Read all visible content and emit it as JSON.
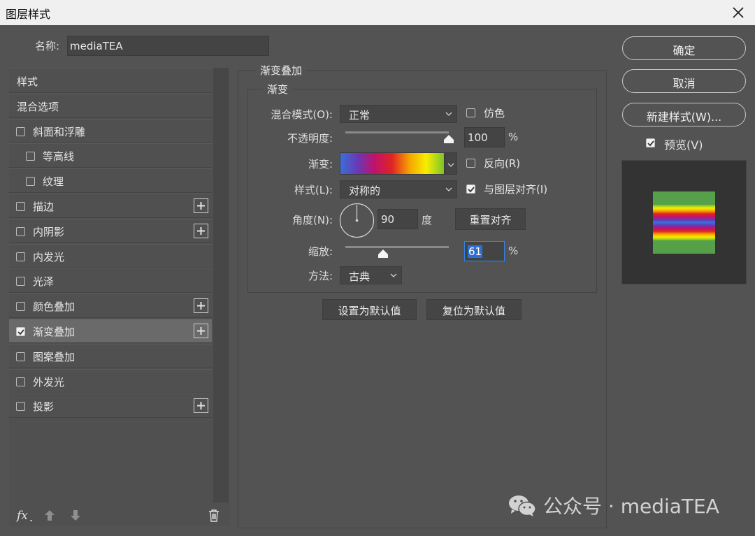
{
  "window": {
    "title": "图层样式"
  },
  "name_field": {
    "label": "名称:",
    "value": "mediaTEA"
  },
  "sidebar": {
    "items": [
      {
        "label": "样式",
        "checkbox": false,
        "checked": false,
        "plus": false,
        "indent": false,
        "selected": false
      },
      {
        "label": "混合选项",
        "checkbox": false,
        "checked": false,
        "plus": false,
        "indent": false,
        "selected": false
      },
      {
        "label": "斜面和浮雕",
        "checkbox": true,
        "checked": false,
        "plus": false,
        "indent": false,
        "selected": false
      },
      {
        "label": "等高线",
        "checkbox": true,
        "checked": false,
        "plus": false,
        "indent": true,
        "selected": false
      },
      {
        "label": "纹理",
        "checkbox": true,
        "checked": false,
        "plus": false,
        "indent": true,
        "selected": false
      },
      {
        "label": "描边",
        "checkbox": true,
        "checked": false,
        "plus": true,
        "indent": false,
        "selected": false
      },
      {
        "label": "内阴影",
        "checkbox": true,
        "checked": false,
        "plus": true,
        "indent": false,
        "selected": false
      },
      {
        "label": "内发光",
        "checkbox": true,
        "checked": false,
        "plus": false,
        "indent": false,
        "selected": false
      },
      {
        "label": "光泽",
        "checkbox": true,
        "checked": false,
        "plus": false,
        "indent": false,
        "selected": false
      },
      {
        "label": "颜色叠加",
        "checkbox": true,
        "checked": false,
        "plus": true,
        "indent": false,
        "selected": false
      },
      {
        "label": "渐变叠加",
        "checkbox": true,
        "checked": true,
        "plus": true,
        "indent": false,
        "selected": true
      },
      {
        "label": "图案叠加",
        "checkbox": true,
        "checked": false,
        "plus": false,
        "indent": false,
        "selected": false
      },
      {
        "label": "外发光",
        "checkbox": true,
        "checked": false,
        "plus": false,
        "indent": false,
        "selected": false
      },
      {
        "label": "投影",
        "checkbox": true,
        "checked": false,
        "plus": true,
        "indent": false,
        "selected": false
      }
    ],
    "bottom_icons": [
      "fx-icon",
      "move-up-icon",
      "move-down-icon",
      "trash-icon"
    ]
  },
  "panel": {
    "title": "渐变叠加",
    "group_title": "渐变",
    "blend_mode": {
      "label": "混合模式(O):",
      "value": "正常"
    },
    "dither": {
      "label": "仿色",
      "checked": false
    },
    "opacity": {
      "label": "不透明度:",
      "value": "100",
      "unit": "%",
      "level": 1.0
    },
    "gradient": {
      "label": "渐变:",
      "colors": [
        "#3a6fd8",
        "#6a37b6",
        "#c1126a",
        "#e02424",
        "#f5a600",
        "#f6ee00",
        "#7cc52a"
      ]
    },
    "reverse": {
      "label": "反向(R)",
      "checked": false
    },
    "style": {
      "label": "样式(L):",
      "value": "对称的"
    },
    "align_layer": {
      "label": "与图层对齐(I)",
      "checked": true
    },
    "angle": {
      "label": "角度(N):",
      "value": "90",
      "unit": "度"
    },
    "reset_align_button": "重置对齐",
    "scale": {
      "label": "缩放:",
      "value": "61",
      "unit": "%",
      "level": 0.61
    },
    "method": {
      "label": "方法:",
      "value": "古典"
    },
    "set_default_button": "设置为默认值",
    "reset_default_button": "复位为默认值"
  },
  "right": {
    "ok_button": "确定",
    "cancel_button": "取消",
    "new_style_button": "新建样式(W)...",
    "preview": {
      "label": "预览(V)",
      "checked": true
    },
    "preview_swatch": {
      "base_color": "#56a04a"
    }
  },
  "watermark": {
    "text": "公众号 · mediaTEA"
  }
}
